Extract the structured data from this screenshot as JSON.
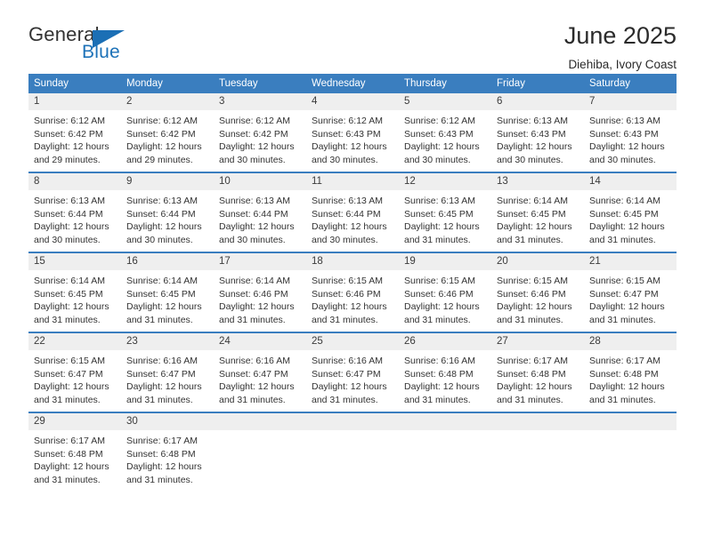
{
  "logo": {
    "word_one": "General",
    "word_two": "Blue",
    "triangle_icon": "triangle-icon",
    "accent_color": "#1b6fb5"
  },
  "header": {
    "title": "June 2025",
    "subtitle": "Diehiba, Ivory Coast"
  },
  "calendar": {
    "header_bg": "#3a7ebf",
    "daynum_bg": "#efefef",
    "weekdays": [
      "Sunday",
      "Monday",
      "Tuesday",
      "Wednesday",
      "Thursday",
      "Friday",
      "Saturday"
    ],
    "weeks": [
      [
        {
          "day": "1",
          "sunrise": "Sunrise: 6:12 AM",
          "sunset": "Sunset: 6:42 PM",
          "daylight": "Daylight: 12 hours and 29 minutes."
        },
        {
          "day": "2",
          "sunrise": "Sunrise: 6:12 AM",
          "sunset": "Sunset: 6:42 PM",
          "daylight": "Daylight: 12 hours and 29 minutes."
        },
        {
          "day": "3",
          "sunrise": "Sunrise: 6:12 AM",
          "sunset": "Sunset: 6:42 PM",
          "daylight": "Daylight: 12 hours and 30 minutes."
        },
        {
          "day": "4",
          "sunrise": "Sunrise: 6:12 AM",
          "sunset": "Sunset: 6:43 PM",
          "daylight": "Daylight: 12 hours and 30 minutes."
        },
        {
          "day": "5",
          "sunrise": "Sunrise: 6:12 AM",
          "sunset": "Sunset: 6:43 PM",
          "daylight": "Daylight: 12 hours and 30 minutes."
        },
        {
          "day": "6",
          "sunrise": "Sunrise: 6:13 AM",
          "sunset": "Sunset: 6:43 PM",
          "daylight": "Daylight: 12 hours and 30 minutes."
        },
        {
          "day": "7",
          "sunrise": "Sunrise: 6:13 AM",
          "sunset": "Sunset: 6:43 PM",
          "daylight": "Daylight: 12 hours and 30 minutes."
        }
      ],
      [
        {
          "day": "8",
          "sunrise": "Sunrise: 6:13 AM",
          "sunset": "Sunset: 6:44 PM",
          "daylight": "Daylight: 12 hours and 30 minutes."
        },
        {
          "day": "9",
          "sunrise": "Sunrise: 6:13 AM",
          "sunset": "Sunset: 6:44 PM",
          "daylight": "Daylight: 12 hours and 30 minutes."
        },
        {
          "day": "10",
          "sunrise": "Sunrise: 6:13 AM",
          "sunset": "Sunset: 6:44 PM",
          "daylight": "Daylight: 12 hours and 30 minutes."
        },
        {
          "day": "11",
          "sunrise": "Sunrise: 6:13 AM",
          "sunset": "Sunset: 6:44 PM",
          "daylight": "Daylight: 12 hours and 30 minutes."
        },
        {
          "day": "12",
          "sunrise": "Sunrise: 6:13 AM",
          "sunset": "Sunset: 6:45 PM",
          "daylight": "Daylight: 12 hours and 31 minutes."
        },
        {
          "day": "13",
          "sunrise": "Sunrise: 6:14 AM",
          "sunset": "Sunset: 6:45 PM",
          "daylight": "Daylight: 12 hours and 31 minutes."
        },
        {
          "day": "14",
          "sunrise": "Sunrise: 6:14 AM",
          "sunset": "Sunset: 6:45 PM",
          "daylight": "Daylight: 12 hours and 31 minutes."
        }
      ],
      [
        {
          "day": "15",
          "sunrise": "Sunrise: 6:14 AM",
          "sunset": "Sunset: 6:45 PM",
          "daylight": "Daylight: 12 hours and 31 minutes."
        },
        {
          "day": "16",
          "sunrise": "Sunrise: 6:14 AM",
          "sunset": "Sunset: 6:45 PM",
          "daylight": "Daylight: 12 hours and 31 minutes."
        },
        {
          "day": "17",
          "sunrise": "Sunrise: 6:14 AM",
          "sunset": "Sunset: 6:46 PM",
          "daylight": "Daylight: 12 hours and 31 minutes."
        },
        {
          "day": "18",
          "sunrise": "Sunrise: 6:15 AM",
          "sunset": "Sunset: 6:46 PM",
          "daylight": "Daylight: 12 hours and 31 minutes."
        },
        {
          "day": "19",
          "sunrise": "Sunrise: 6:15 AM",
          "sunset": "Sunset: 6:46 PM",
          "daylight": "Daylight: 12 hours and 31 minutes."
        },
        {
          "day": "20",
          "sunrise": "Sunrise: 6:15 AM",
          "sunset": "Sunset: 6:46 PM",
          "daylight": "Daylight: 12 hours and 31 minutes."
        },
        {
          "day": "21",
          "sunrise": "Sunrise: 6:15 AM",
          "sunset": "Sunset: 6:47 PM",
          "daylight": "Daylight: 12 hours and 31 minutes."
        }
      ],
      [
        {
          "day": "22",
          "sunrise": "Sunrise: 6:15 AM",
          "sunset": "Sunset: 6:47 PM",
          "daylight": "Daylight: 12 hours and 31 minutes."
        },
        {
          "day": "23",
          "sunrise": "Sunrise: 6:16 AM",
          "sunset": "Sunset: 6:47 PM",
          "daylight": "Daylight: 12 hours and 31 minutes."
        },
        {
          "day": "24",
          "sunrise": "Sunrise: 6:16 AM",
          "sunset": "Sunset: 6:47 PM",
          "daylight": "Daylight: 12 hours and 31 minutes."
        },
        {
          "day": "25",
          "sunrise": "Sunrise: 6:16 AM",
          "sunset": "Sunset: 6:47 PM",
          "daylight": "Daylight: 12 hours and 31 minutes."
        },
        {
          "day": "26",
          "sunrise": "Sunrise: 6:16 AM",
          "sunset": "Sunset: 6:48 PM",
          "daylight": "Daylight: 12 hours and 31 minutes."
        },
        {
          "day": "27",
          "sunrise": "Sunrise: 6:17 AM",
          "sunset": "Sunset: 6:48 PM",
          "daylight": "Daylight: 12 hours and 31 minutes."
        },
        {
          "day": "28",
          "sunrise": "Sunrise: 6:17 AM",
          "sunset": "Sunset: 6:48 PM",
          "daylight": "Daylight: 12 hours and 31 minutes."
        }
      ],
      [
        {
          "day": "29",
          "sunrise": "Sunrise: 6:17 AM",
          "sunset": "Sunset: 6:48 PM",
          "daylight": "Daylight: 12 hours and 31 minutes."
        },
        {
          "day": "30",
          "sunrise": "Sunrise: 6:17 AM",
          "sunset": "Sunset: 6:48 PM",
          "daylight": "Daylight: 12 hours and 31 minutes."
        },
        {
          "day": "",
          "sunrise": "",
          "sunset": "",
          "daylight": ""
        },
        {
          "day": "",
          "sunrise": "",
          "sunset": "",
          "daylight": ""
        },
        {
          "day": "",
          "sunrise": "",
          "sunset": "",
          "daylight": ""
        },
        {
          "day": "",
          "sunrise": "",
          "sunset": "",
          "daylight": ""
        },
        {
          "day": "",
          "sunrise": "",
          "sunset": "",
          "daylight": ""
        }
      ]
    ]
  }
}
